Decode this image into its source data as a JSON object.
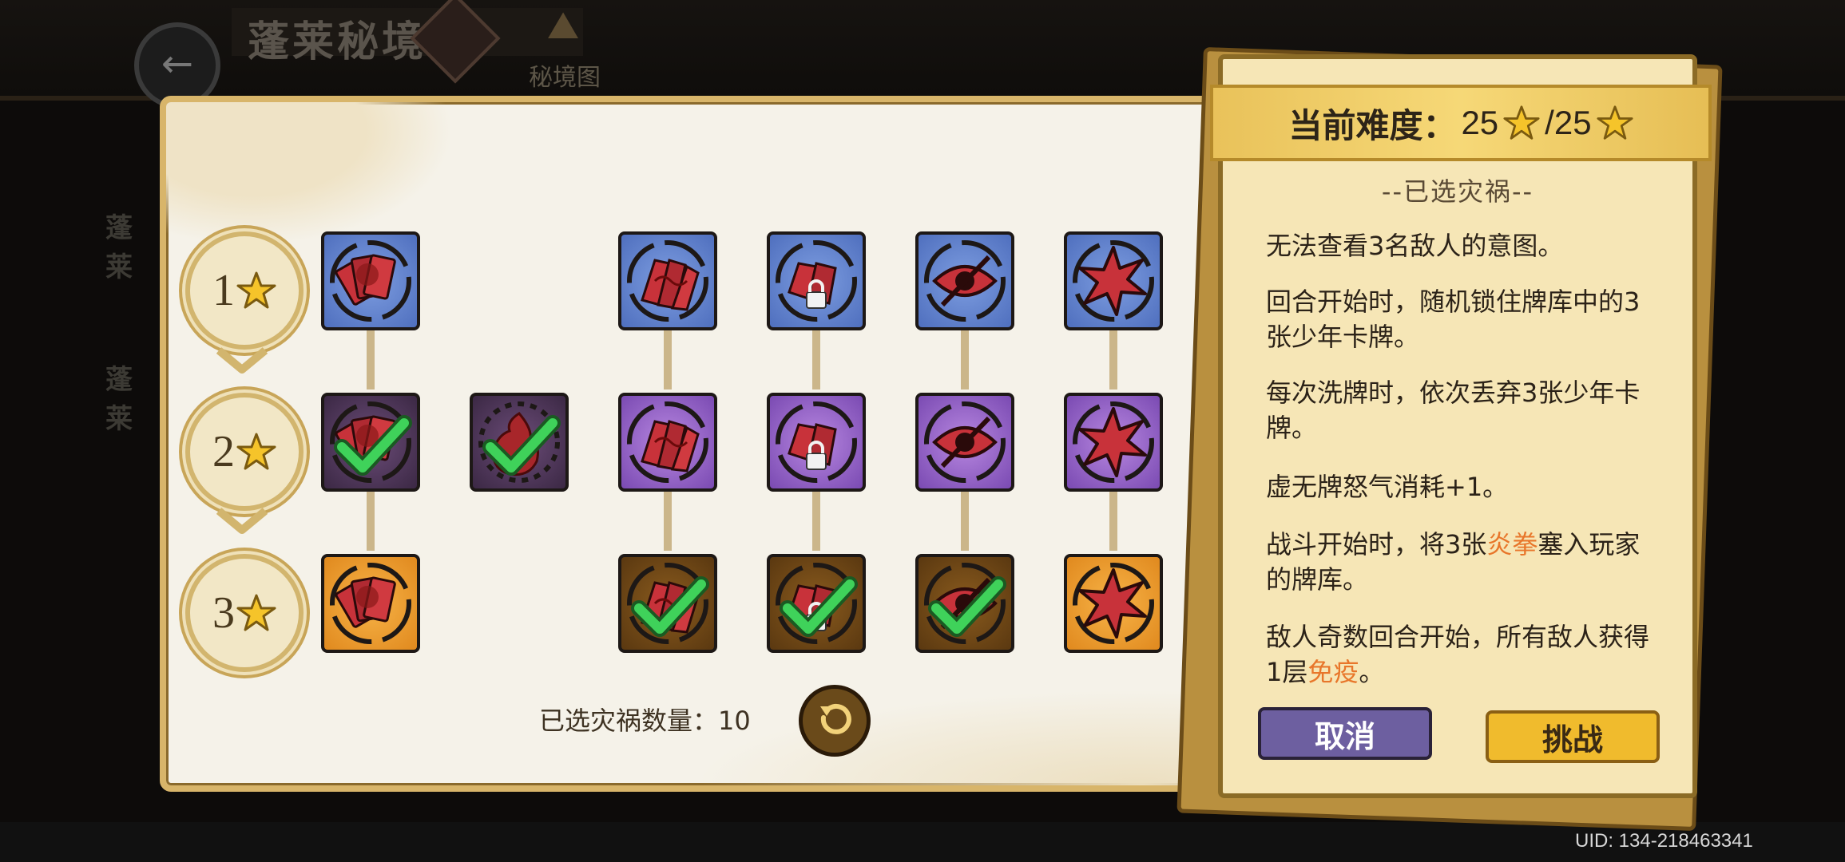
{
  "background": {
    "title": "蓬莱秘境",
    "map_label": "秘境图",
    "side_labels": [
      "蓬莱",
      "蓬莱"
    ],
    "back_icon": "back-arrow-icon",
    "map_icon": "mountain-icon"
  },
  "uid": "UID: 134-218463341",
  "levels": [
    {
      "label": "1"
    },
    {
      "label": "2"
    },
    {
      "label": "3"
    }
  ],
  "curses": {
    "row1": [
      "cards-fan-icon",
      "cards-swirl-icon",
      "cards-lock-icon",
      "crossed-eye-icon",
      "spiky-shell-icon"
    ],
    "row2": [
      "cards-fan-icon selected",
      "fire-swirl-icon selected",
      "cards-swirl-icon",
      "cards-lock-icon",
      "crossed-eye-icon",
      "spiky-shell-icon"
    ],
    "row3": [
      "cards-fan-icon",
      "cards-swirl-icon selected",
      "cards-lock-icon selected",
      "crossed-eye-icon selected",
      "spiky-shell-icon"
    ]
  },
  "selected_count_label": "已选灾祸数量：",
  "selected_count": "10",
  "card": {
    "difficulty_label": "当前难度：",
    "difficulty_current": "25",
    "difficulty_max": "/25",
    "section_title": "--已选灾祸--",
    "descriptions": [
      {
        "pre": "无法查看3名敌人的意图。",
        "hl": "",
        "post": ""
      },
      {
        "pre": "回合开始时，随机锁住牌库中的3张少年卡牌。",
        "hl": "",
        "post": ""
      },
      {
        "pre": "每次洗牌时，依次丢弃3张少年卡牌。",
        "hl": "",
        "post": ""
      },
      {
        "pre": "虚无牌怒气消耗+1。",
        "hl": "",
        "post": ""
      },
      {
        "pre": "战斗开始时，将3张",
        "hl": "炎拳",
        "post": "塞入玩家的牌库。"
      },
      {
        "pre": "敌人奇数回合开始，所有敌人获得1层",
        "hl": "免疫",
        "post": "。"
      }
    ],
    "cancel": "取消",
    "challenge": "挑战"
  },
  "colors": {
    "accent": "#e8762a",
    "gold": "#d8b56a",
    "check": "#3fd25a"
  }
}
